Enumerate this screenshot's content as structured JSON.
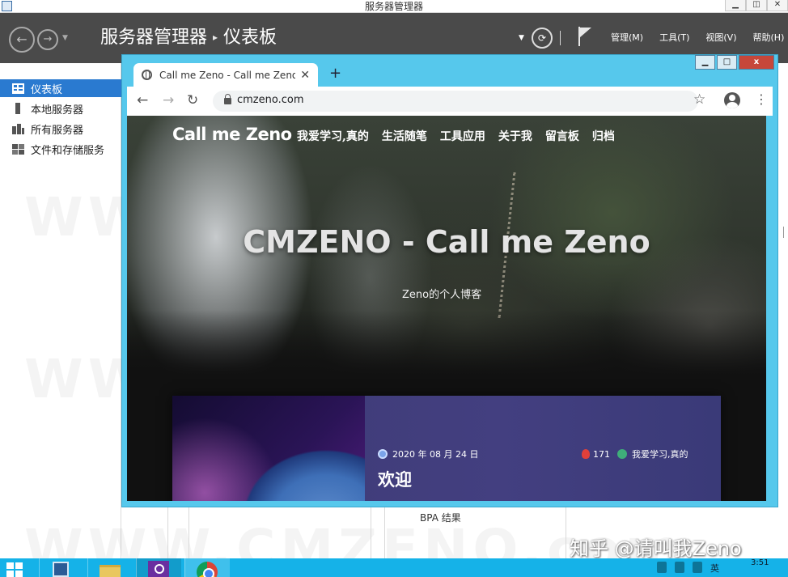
{
  "server_manager": {
    "window_title": "服务器管理器",
    "window_buttons": {
      "minimize": "▁",
      "restore": "◫",
      "close": "✕"
    },
    "breadcrumb": {
      "root": "服务器管理器",
      "separator": "▸",
      "current": "仪表板"
    },
    "menu": [
      "管理(M)",
      "工具(T)",
      "视图(V)",
      "帮助(H)"
    ],
    "sidebar": [
      {
        "label": "仪表板",
        "icon": "dashboard-grid-icon",
        "active": true
      },
      {
        "label": "本地服务器",
        "icon": "server-icon"
      },
      {
        "label": "所有服务器",
        "icon": "servers-icon"
      },
      {
        "label": "文件和存储服务",
        "icon": "storage-icon"
      }
    ],
    "bpa_label": "BPA 结果"
  },
  "browser": {
    "tab_title": "Call me Zeno - Call me Zeno",
    "url": "cmzeno.com",
    "window_buttons": {
      "minimize": "▁",
      "restore": "□",
      "close": "x"
    }
  },
  "website": {
    "brand": "Call me Zeno",
    "nav": [
      "我爱学习,真的",
      "生活随笔",
      "工具应用",
      "关于我",
      "留言板",
      "归档"
    ],
    "hero_title": "CMZENO - Call me Zeno",
    "hero_subtitle": "Zeno的个人博客",
    "post": {
      "date": "2020 年 08 月 24 日",
      "views": "171",
      "category": "我爱学习,真的",
      "title": "欢迎"
    }
  },
  "watermark": {
    "text": "WWW.CMZENO.com",
    "zhihu": "知乎 @请叫我Zeno"
  },
  "taskbar": {
    "time": "3:51",
    "ime": "英"
  },
  "colors": {
    "taskbar": "#15b2e8",
    "chrome_frame": "#56c8ec",
    "sm_header": "#4a4a4a",
    "sidebar_active": "#2a7ad0"
  }
}
